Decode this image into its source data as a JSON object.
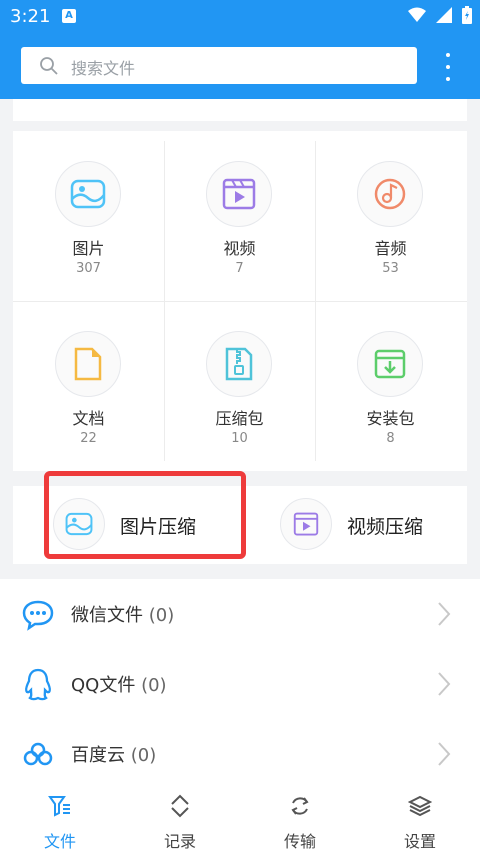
{
  "status_bar": {
    "time": "3:21",
    "notification_badge": "A"
  },
  "search": {
    "placeholder": "搜索文件"
  },
  "categories": [
    {
      "label": "图片",
      "count": "307",
      "icon": "image-icon"
    },
    {
      "label": "视频",
      "count": "7",
      "icon": "video-icon"
    },
    {
      "label": "音频",
      "count": "53",
      "icon": "audio-icon"
    },
    {
      "label": "文档",
      "count": "22",
      "icon": "document-icon"
    },
    {
      "label": "压缩包",
      "count": "10",
      "icon": "archive-icon"
    },
    {
      "label": "安装包",
      "count": "8",
      "icon": "install-package-icon"
    }
  ],
  "compress": {
    "image_label": "图片压缩",
    "video_label": "视频压缩"
  },
  "sources": [
    {
      "label": "微信文件",
      "count": "(0)",
      "icon": "wechat-icon"
    },
    {
      "label": "QQ文件",
      "count": "(0)",
      "icon": "qq-icon"
    },
    {
      "label": "百度云",
      "count": "(0)",
      "icon": "baidu-cloud-icon"
    }
  ],
  "tabs": [
    {
      "label": "文件",
      "icon": "files-icon",
      "active": true
    },
    {
      "label": "记录",
      "icon": "history-icon",
      "active": false
    },
    {
      "label": "传输",
      "icon": "transfer-icon",
      "active": false
    },
    {
      "label": "设置",
      "icon": "settings-icon",
      "active": false
    }
  ],
  "colors": {
    "accent": "#2196f3",
    "highlight": "#ee3b3b",
    "image": "#4fc3f7",
    "video": "#9c7be6",
    "audio": "#f08a6a",
    "document": "#f5b942",
    "archive": "#4fc3d9",
    "install": "#5ccd6a"
  }
}
